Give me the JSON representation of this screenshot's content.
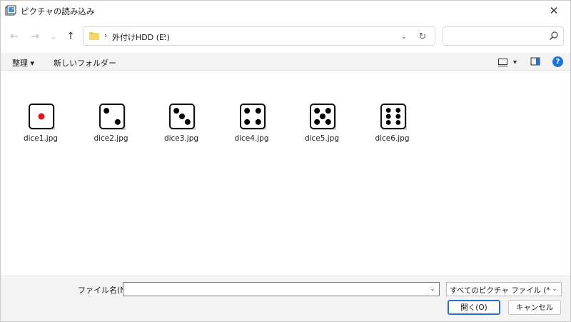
{
  "window": {
    "title": "ピクチャの読み込み",
    "close_glyph": "✕"
  },
  "nav": {
    "back_glyph": "←",
    "forward_glyph": "→",
    "recent_glyph": "⌄",
    "up_glyph": "↑",
    "address_sep": "›",
    "address_path": "外付けHDD (E:)",
    "address_dropdown_glyph": "⌄",
    "refresh_glyph": "↻",
    "search_placeholder": ""
  },
  "toolbar": {
    "organize_label": "整理 ▾",
    "new_folder_label": "新しいフォルダー",
    "view_caret": "▾",
    "help_label": "?"
  },
  "files": [
    {
      "name": "dice1.jpg",
      "pips": 1
    },
    {
      "name": "dice2.jpg",
      "pips": 2
    },
    {
      "name": "dice3.jpg",
      "pips": 3
    },
    {
      "name": "dice4.jpg",
      "pips": 4
    },
    {
      "name": "dice5.jpg",
      "pips": 5
    },
    {
      "name": "dice6.jpg",
      "pips": 6
    }
  ],
  "bottom": {
    "filename_label": "ファイル名(N):",
    "filename_value": "",
    "dropdown_glyph": "⌄",
    "filter_value": "すべてのピクチャ ファイル (*.bmp;*.g",
    "open_label": "開く(O)",
    "cancel_label": "キャンセル"
  },
  "colors": {
    "accent": "#2a6fc9",
    "folder": "#f4c542",
    "pip_red": "#e0141e",
    "pip_black": "#000000",
    "help": "#1a73d9"
  }
}
